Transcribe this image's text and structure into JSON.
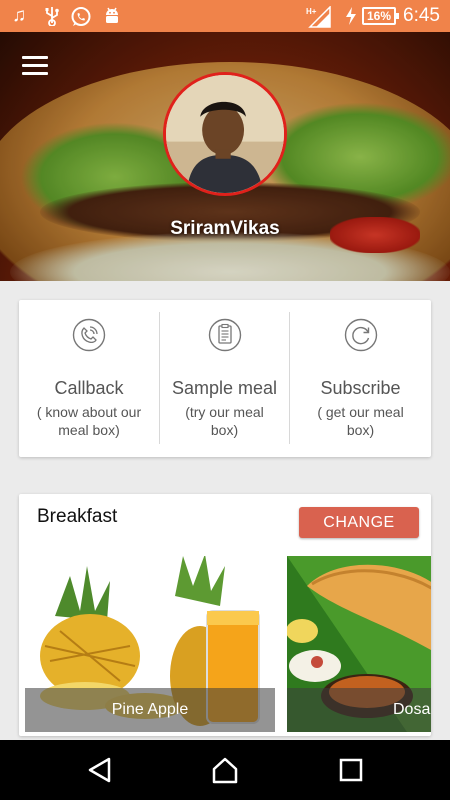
{
  "status_bar": {
    "icons": [
      "music-icon",
      "usb-icon",
      "whatsapp-icon",
      "android-debug-icon",
      "signal-hplus-icon",
      "charging-icon"
    ],
    "battery": "16%",
    "time": "6:45",
    "color": "#f0834a"
  },
  "header": {
    "menu_icon": "hamburger-menu-icon",
    "profile_name": "SriramVikas",
    "avatar_border_color": "#e0211b"
  },
  "options": [
    {
      "icon": "callback-icon",
      "title": "Callback",
      "description": "( know about our meal box)"
    },
    {
      "icon": "sample-meal-icon",
      "title": "Sample meal",
      "description": "(try our meal box)"
    },
    {
      "icon": "subscribe-icon",
      "title": "Subscribe",
      "description": "( get our meal box)"
    }
  ],
  "meal": {
    "title": "Breakfast",
    "change_label": "CHANGE",
    "change_color": "#d9624f",
    "items": [
      {
        "name": "Pine Apple"
      },
      {
        "name": "Dosa"
      }
    ]
  },
  "nav_bar": {
    "icons": [
      "back-icon",
      "home-icon",
      "recents-icon"
    ]
  }
}
